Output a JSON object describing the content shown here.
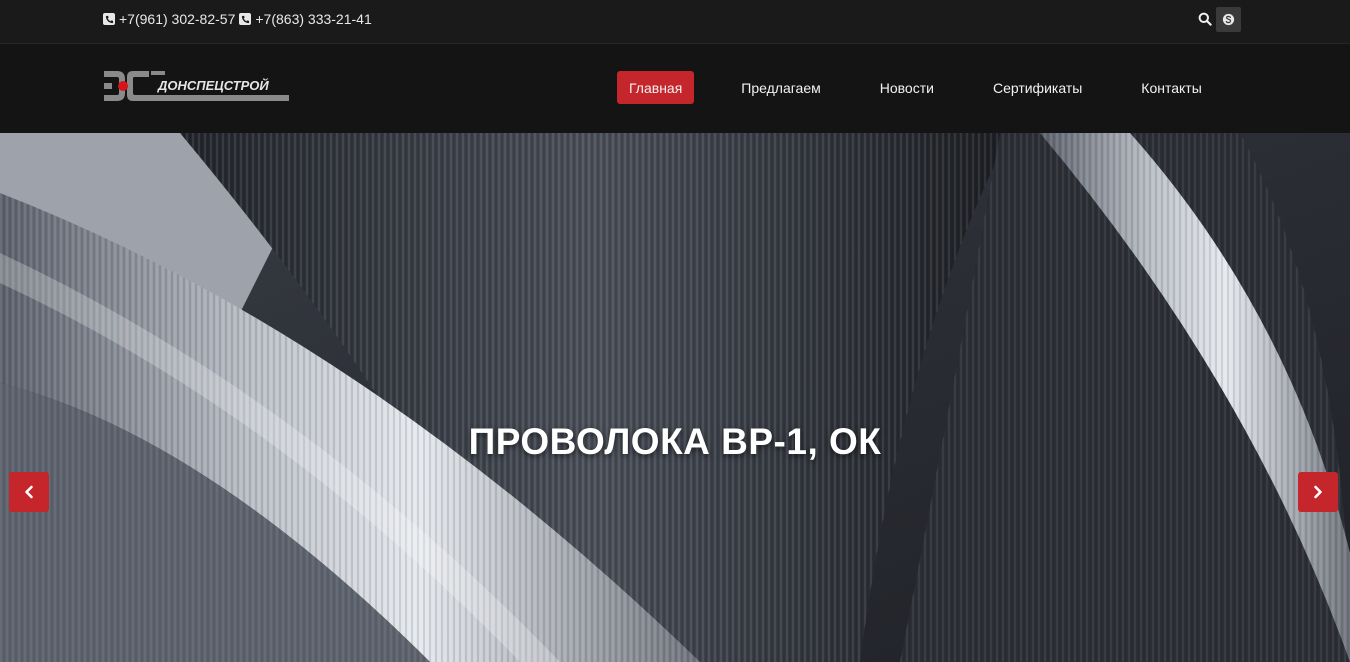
{
  "topbar": {
    "phones": [
      {
        "icon": "phone-icon",
        "number": "+7(961) 302-82-57"
      },
      {
        "icon": "phone-icon",
        "number": "+7(863) 333-21-41"
      }
    ],
    "icons": [
      "search-icon",
      "skype-icon"
    ]
  },
  "header": {
    "logo_text": "ДОНСПЕЦСТРОЙ",
    "nav": [
      {
        "label": "Главная",
        "active": true
      },
      {
        "label": "Предлагаем",
        "active": false
      },
      {
        "label": "Новости",
        "active": false
      },
      {
        "label": "Сертификаты",
        "active": false
      },
      {
        "label": "Контакты",
        "active": false
      }
    ]
  },
  "slider": {
    "title": "ПРОВОЛОКА ВР-1, ОК",
    "prev_icon": "chevron-left-icon",
    "next_icon": "chevron-right-icon"
  },
  "colors": {
    "accent": "#c4262c",
    "topbar_bg": "#1a1a1a",
    "header_bg": "#141414"
  }
}
